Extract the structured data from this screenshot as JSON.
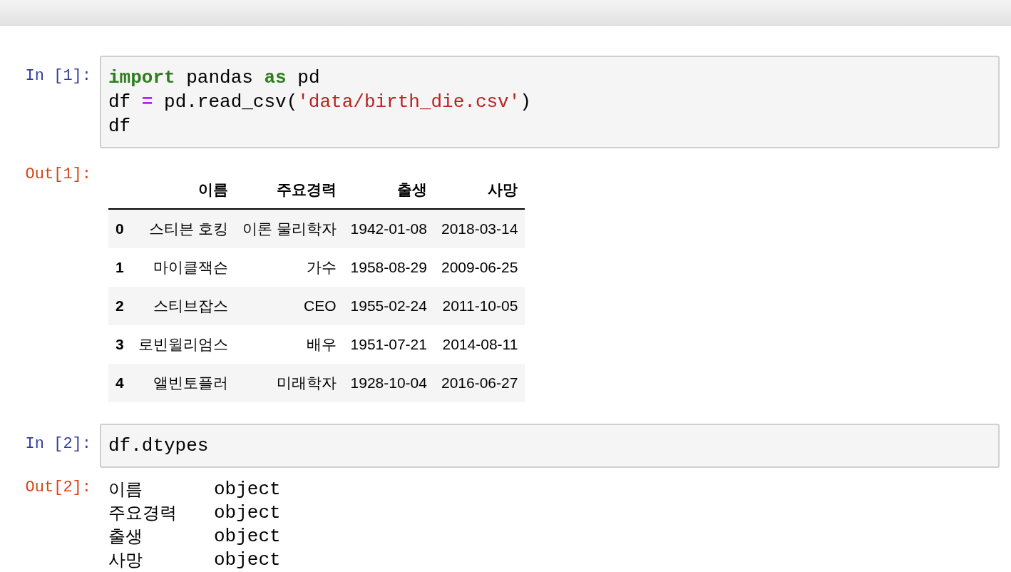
{
  "cells": [
    {
      "kind": "code",
      "prompt": "In [1]:",
      "lines": [
        [
          {
            "kind": "keyword",
            "text": "import"
          },
          {
            "kind": "plain",
            "text": " pandas "
          },
          {
            "kind": "keyword",
            "text": "as"
          },
          {
            "kind": "plain",
            "text": " pd"
          }
        ],
        [
          {
            "kind": "plain",
            "text": "df "
          },
          {
            "kind": "operator",
            "text": "="
          },
          {
            "kind": "plain",
            "text": " pd.read_csv("
          },
          {
            "kind": "string",
            "text": "'data/birth_die.csv'"
          },
          {
            "kind": "plain",
            "text": ")"
          }
        ],
        [
          {
            "kind": "plain",
            "text": "df"
          }
        ]
      ]
    },
    {
      "kind": "table",
      "prompt": "Out[1]:",
      "columns": [
        "이름",
        "주요경력",
        "출생",
        "사망"
      ],
      "rows": [
        {
          "index": "0",
          "cells": [
            "스티븐 호킹",
            "이론 물리학자",
            "1942-01-08",
            "2018-03-14"
          ]
        },
        {
          "index": "1",
          "cells": [
            "마이클잭슨",
            "가수",
            "1958-08-29",
            "2009-06-25"
          ]
        },
        {
          "index": "2",
          "cells": [
            "스티브잡스",
            "CEO",
            "1955-02-24",
            "2011-10-05"
          ]
        },
        {
          "index": "3",
          "cells": [
            "로빈윌리엄스",
            "배우",
            "1951-07-21",
            "2014-08-11"
          ]
        },
        {
          "index": "4",
          "cells": [
            "앨빈토플러",
            "미래학자",
            "1928-10-04",
            "2016-06-27"
          ]
        }
      ]
    },
    {
      "kind": "code",
      "prompt": "In [2]:",
      "lines": [
        [
          {
            "kind": "plain",
            "text": "df.dtypes"
          }
        ]
      ]
    },
    {
      "kind": "text",
      "prompt": "Out[2]:",
      "lines": [
        {
          "name": "이름",
          "dtype": "object"
        },
        {
          "name": "주요경력",
          "dtype": "object"
        },
        {
          "name": "출생",
          "dtype": "object"
        },
        {
          "name": "사망",
          "dtype": "object"
        }
      ]
    }
  ]
}
